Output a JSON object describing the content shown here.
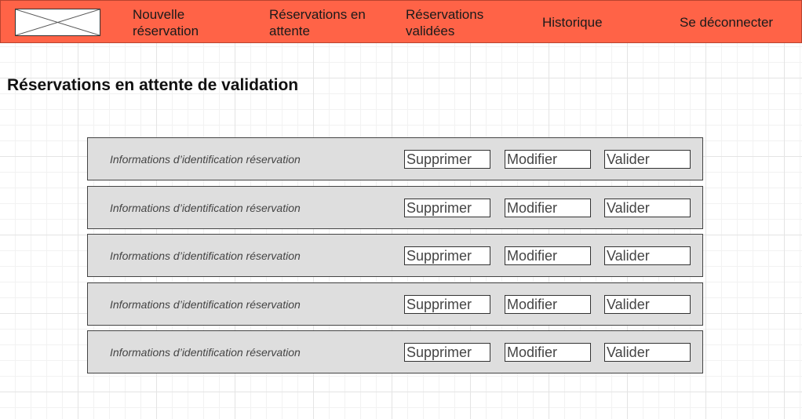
{
  "nav": {
    "logo_icon": "image-placeholder-icon",
    "items": [
      {
        "line1": "Nouvelle",
        "line2": "réservation"
      },
      {
        "line1": "Réservations en",
        "line2": "attente"
      },
      {
        "line1": "Réservations",
        "line2": "validées"
      },
      {
        "line1": "Historique"
      },
      {
        "line1": "Se déconnecter"
      }
    ],
    "colors": {
      "background": "#ff6347"
    }
  },
  "page": {
    "title": "Réservations en attente de validation"
  },
  "reservations": [
    {
      "info": "Informations d’identification réservation",
      "delete_label": "Supprimer",
      "edit_label": "Modifier",
      "validate_label": "Valider"
    },
    {
      "info": "Informations d’identification réservation",
      "delete_label": "Supprimer",
      "edit_label": "Modifier",
      "validate_label": "Valider"
    },
    {
      "info": "Informations d’identification réservation",
      "delete_label": "Supprimer",
      "edit_label": "Modifier",
      "validate_label": "Valider"
    },
    {
      "info": "Informations d’identification réservation",
      "delete_label": "Supprimer",
      "edit_label": "Modifier",
      "validate_label": "Valider"
    },
    {
      "info": "Informations d’identification réservation",
      "delete_label": "Supprimer",
      "edit_label": "Modifier",
      "validate_label": "Valider"
    }
  ]
}
